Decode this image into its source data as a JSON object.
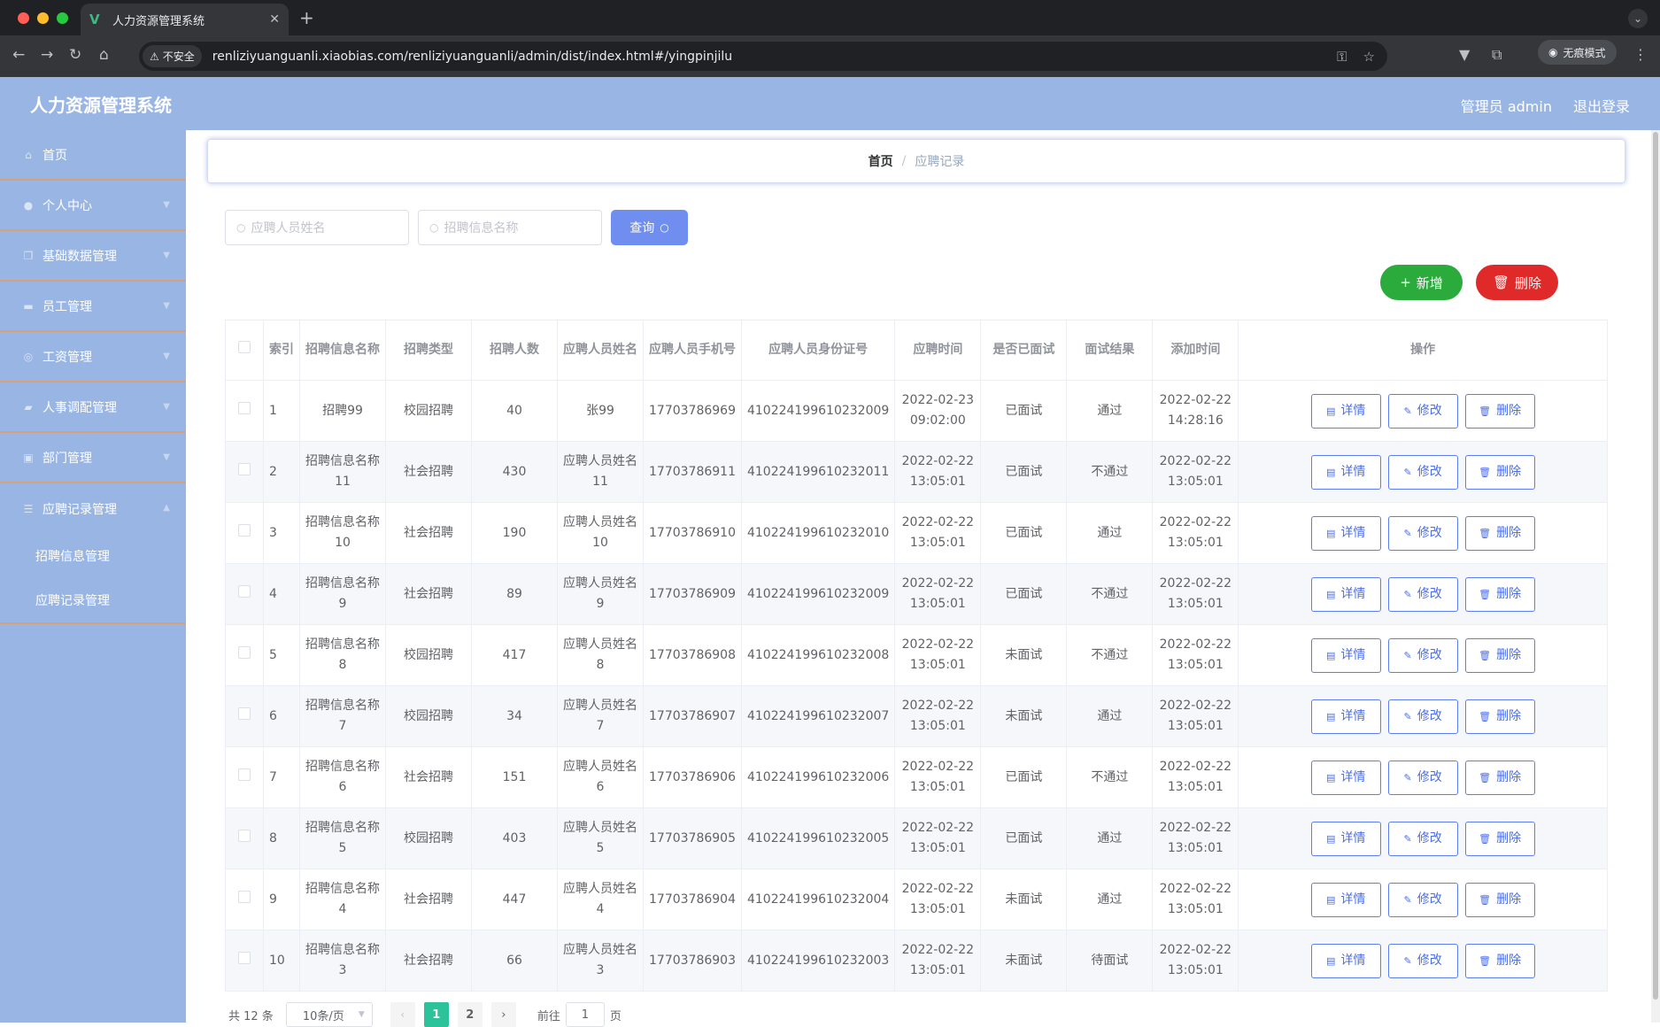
{
  "browser": {
    "tab_title": "人力资源管理系统",
    "security_label": "不安全",
    "url": "renliziyuanguanli.xiaobias.com/renliziyuanguanli/admin/dist/index.html#/yingpinjilu",
    "incognito_label": "无痕模式"
  },
  "header": {
    "title": "人力资源管理系统",
    "user_label": "管理员 admin",
    "logout_label": "退出登录"
  },
  "sidebar": {
    "items": [
      {
        "label": "首页",
        "icon": "home-icon"
      },
      {
        "label": "个人中心",
        "icon": "user-icon"
      },
      {
        "label": "基础数据管理",
        "icon": "copy-icon"
      },
      {
        "label": "员工管理",
        "icon": "briefcase-icon"
      },
      {
        "label": "工资管理",
        "icon": "compass-icon"
      },
      {
        "label": "人事调配管理",
        "icon": "chat-icon"
      },
      {
        "label": "部门管理",
        "icon": "clipboard-icon"
      },
      {
        "label": "应聘记录管理",
        "icon": "menu-icon"
      }
    ],
    "subitems": [
      {
        "label": "招聘信息管理"
      },
      {
        "label": "应聘记录管理"
      }
    ]
  },
  "breadcrumb": {
    "home": "首页",
    "separator": "/",
    "current": "应聘记录"
  },
  "search": {
    "name_placeholder": "应聘人员姓名",
    "info_placeholder": "招聘信息名称",
    "query_label": "查询"
  },
  "actions": {
    "add_label": "新增",
    "delete_label": "删除"
  },
  "table": {
    "headers": [
      "索引",
      "招聘信息名称",
      "招聘类型",
      "招聘人数",
      "应聘人员姓名",
      "应聘人员手机号",
      "应聘人员身份证号",
      "应聘时间",
      "是否已面试",
      "面试结果",
      "添加时间",
      "操作"
    ],
    "op_labels": {
      "detail": "详情",
      "edit": "修改",
      "delete": "删除"
    },
    "rows": [
      {
        "idx": "1",
        "info": "招聘99",
        "type": "校园招聘",
        "count": "40",
        "name": "张99",
        "phone": "17703786969",
        "idcard": "410224199610232009",
        "apply_time": "2022-02-23 09:02:00",
        "interviewed": "已面试",
        "result": "通过",
        "added": "2022-02-22 14:28:16"
      },
      {
        "idx": "2",
        "info": "招聘信息名称11",
        "type": "社会招聘",
        "count": "430",
        "name": "应聘人员姓名11",
        "phone": "17703786911",
        "idcard": "410224199610232011",
        "apply_time": "2022-02-22 13:05:01",
        "interviewed": "已面试",
        "result": "不通过",
        "added": "2022-02-22 13:05:01"
      },
      {
        "idx": "3",
        "info": "招聘信息名称10",
        "type": "社会招聘",
        "count": "190",
        "name": "应聘人员姓名10",
        "phone": "17703786910",
        "idcard": "410224199610232010",
        "apply_time": "2022-02-22 13:05:01",
        "interviewed": "已面试",
        "result": "通过",
        "added": "2022-02-22 13:05:01"
      },
      {
        "idx": "4",
        "info": "招聘信息名称9",
        "type": "社会招聘",
        "count": "89",
        "name": "应聘人员姓名9",
        "phone": "17703786909",
        "idcard": "410224199610232009",
        "apply_time": "2022-02-22 13:05:01",
        "interviewed": "已面试",
        "result": "不通过",
        "added": "2022-02-22 13:05:01"
      },
      {
        "idx": "5",
        "info": "招聘信息名称8",
        "type": "校园招聘",
        "count": "417",
        "name": "应聘人员姓名8",
        "phone": "17703786908",
        "idcard": "410224199610232008",
        "apply_time": "2022-02-22 13:05:01",
        "interviewed": "未面试",
        "result": "不通过",
        "added": "2022-02-22 13:05:01"
      },
      {
        "idx": "6",
        "info": "招聘信息名称7",
        "type": "校园招聘",
        "count": "34",
        "name": "应聘人员姓名7",
        "phone": "17703786907",
        "idcard": "410224199610232007",
        "apply_time": "2022-02-22 13:05:01",
        "interviewed": "未面试",
        "result": "通过",
        "added": "2022-02-22 13:05:01"
      },
      {
        "idx": "7",
        "info": "招聘信息名称6",
        "type": "社会招聘",
        "count": "151",
        "name": "应聘人员姓名6",
        "phone": "17703786906",
        "idcard": "410224199610232006",
        "apply_time": "2022-02-22 13:05:01",
        "interviewed": "已面试",
        "result": "不通过",
        "added": "2022-02-22 13:05:01"
      },
      {
        "idx": "8",
        "info": "招聘信息名称5",
        "type": "校园招聘",
        "count": "403",
        "name": "应聘人员姓名5",
        "phone": "17703786905",
        "idcard": "410224199610232005",
        "apply_time": "2022-02-22 13:05:01",
        "interviewed": "已面试",
        "result": "通过",
        "added": "2022-02-22 13:05:01"
      },
      {
        "idx": "9",
        "info": "招聘信息名称4",
        "type": "社会招聘",
        "count": "447",
        "name": "应聘人员姓名4",
        "phone": "17703786904",
        "idcard": "410224199610232004",
        "apply_time": "2022-02-22 13:05:01",
        "interviewed": "未面试",
        "result": "通过",
        "added": "2022-02-22 13:05:01"
      },
      {
        "idx": "10",
        "info": "招聘信息名称3",
        "type": "社会招聘",
        "count": "66",
        "name": "应聘人员姓名3",
        "phone": "17703786903",
        "idcard": "410224199610232003",
        "apply_time": "2022-02-22 13:05:01",
        "interviewed": "未面试",
        "result": "待面试",
        "added": "2022-02-22 13:05:01"
      }
    ]
  },
  "pagination": {
    "total": "共 12 条",
    "page_size": "10条/页",
    "pages": [
      "1",
      "2"
    ],
    "current_page": "1",
    "goto_prefix": "前往",
    "goto_value": "1",
    "goto_suffix": "页"
  },
  "colors": {
    "header_bg": "#98b5e4",
    "add_button": "#2bab3c",
    "delete_button": "#e02a2a",
    "query_button": "#6f8ef0",
    "active_page": "#2cc39a"
  }
}
